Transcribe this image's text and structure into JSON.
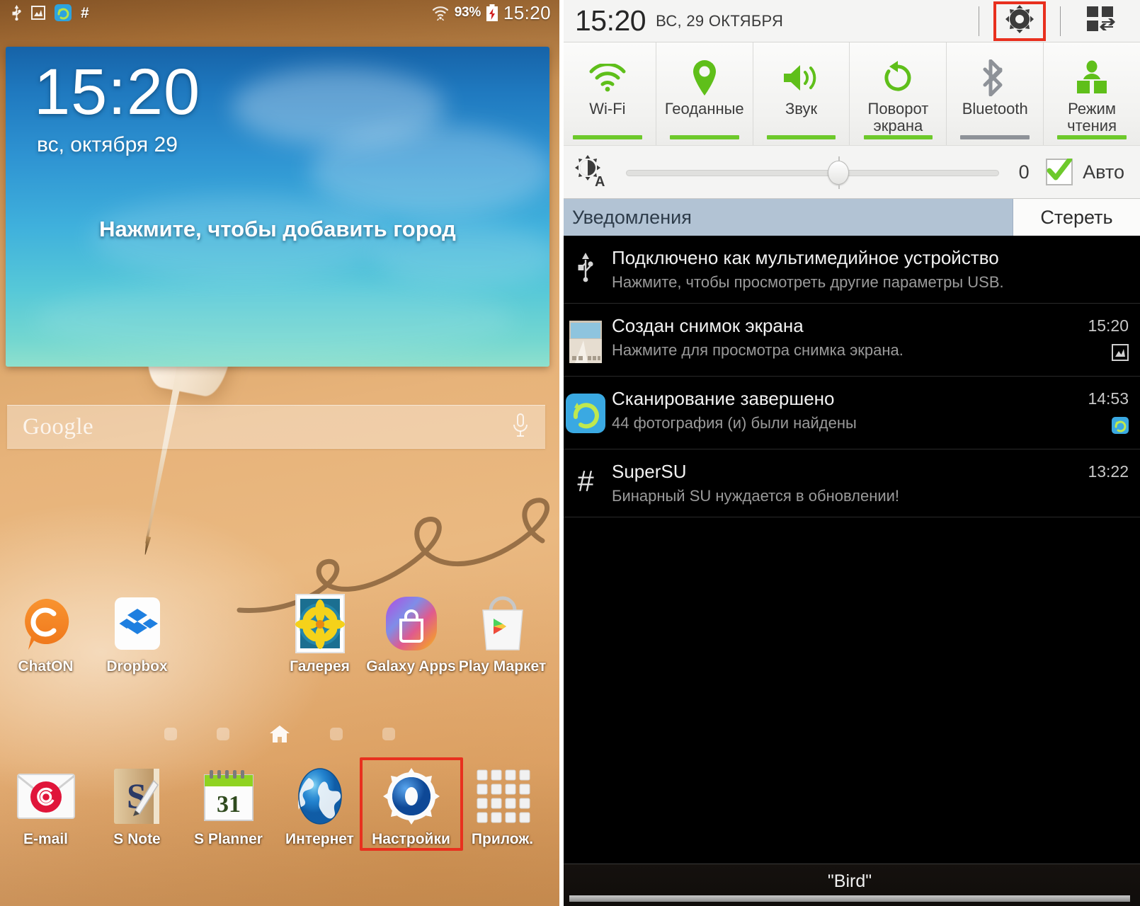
{
  "home": {
    "statusbar": {
      "icons": [
        "usb-icon",
        "screenshot-icon",
        "gallery-scan-icon",
        "supersu-icon"
      ],
      "wifi_icon": "wifi-icon",
      "battery_percent": "93%",
      "battery_icon": "battery-charging-icon",
      "clock": "15:20"
    },
    "clock_widget": {
      "time": "15:20",
      "date": "вс, октября 29",
      "add_city": "Нажмите, чтобы добавить город"
    },
    "search": {
      "placeholder": "Google",
      "mic_icon": "microphone-icon"
    },
    "apps_row1": [
      {
        "label": "ChatON",
        "icon": "chaton-icon"
      },
      {
        "label": "Dropbox",
        "icon": "dropbox-icon"
      },
      {
        "label": "",
        "icon": ""
      },
      {
        "label": "Галерея",
        "icon": "gallery-icon"
      },
      {
        "label": "Galaxy Apps",
        "icon": "galaxy-apps-icon"
      },
      {
        "label": "Play Маркет",
        "icon": "play-store-icon"
      }
    ],
    "apps_row2": [
      {
        "label": "E-mail",
        "icon": "email-icon"
      },
      {
        "label": "S Note",
        "icon": "s-note-icon"
      },
      {
        "label": "S Planner",
        "icon": "s-planner-icon",
        "day": "31"
      },
      {
        "label": "Интернет",
        "icon": "browser-icon"
      },
      {
        "label": "Настройки",
        "icon": "settings-gear-icon",
        "highlighted": true
      },
      {
        "label": "Прилож.",
        "icon": "apps-grid-icon"
      }
    ],
    "page_dots": {
      "count": 5,
      "active_index": 2,
      "home_icon": "house-icon"
    },
    "highlight_color": "#e8301e"
  },
  "shade": {
    "header": {
      "time": "15:20",
      "date": "ВС, 29 ОКТЯБРЯ",
      "settings_icon": "gear-icon",
      "multiwindow_icon": "multi-window-icon",
      "settings_highlighted": true
    },
    "toggles": [
      {
        "label": "Wi-Fi",
        "icon": "wifi-icon",
        "active": true
      },
      {
        "label": "Геоданные",
        "icon": "location-pin-icon",
        "active": true
      },
      {
        "label": "Звук",
        "icon": "sound-on-icon",
        "active": true
      },
      {
        "label": "Поворот экрана",
        "icon": "screen-rotate-icon",
        "active": true
      },
      {
        "label": "Bluetooth",
        "icon": "bluetooth-icon",
        "active": false
      },
      {
        "label": "Режим чтения",
        "icon": "reading-mode-icon",
        "active": true
      }
    ],
    "brightness": {
      "icon": "brightness-auto-icon",
      "value": "0",
      "slider_percent": 57,
      "auto_label": "Авто",
      "auto_checked": true,
      "check_color": "#6dc92b"
    },
    "notifications_header": {
      "title": "Уведомления",
      "clear_label": "Стереть",
      "bar_color": "#b2c3d4"
    },
    "notifications": [
      {
        "icon": "usb-icon",
        "title": "Подключено как мультимедийное устройство",
        "subtitle": "Нажмите, чтобы просмотреть другие параметры USB.",
        "time": "",
        "badge": ""
      },
      {
        "icon": "screenshot-thumbnail",
        "title": "Создан снимок экрана",
        "subtitle": "Нажмите для просмотра снимка экрана.",
        "time": "15:20",
        "badge": "screenshot-badge-icon"
      },
      {
        "icon": "gallery-scan-icon",
        "title": "Сканирование завершено",
        "subtitle": "44 фотография (и) были найдены",
        "time": "14:53",
        "badge": "gallery-scan-badge-icon"
      },
      {
        "icon": "supersu-icon",
        "title": "SuperSU",
        "subtitle": "Бинарный SU нуждается в обновлении!",
        "time": "13:22",
        "badge": ""
      }
    ],
    "now_playing": {
      "track": "\"Bird\""
    },
    "highlight_color": "#e8301e"
  }
}
